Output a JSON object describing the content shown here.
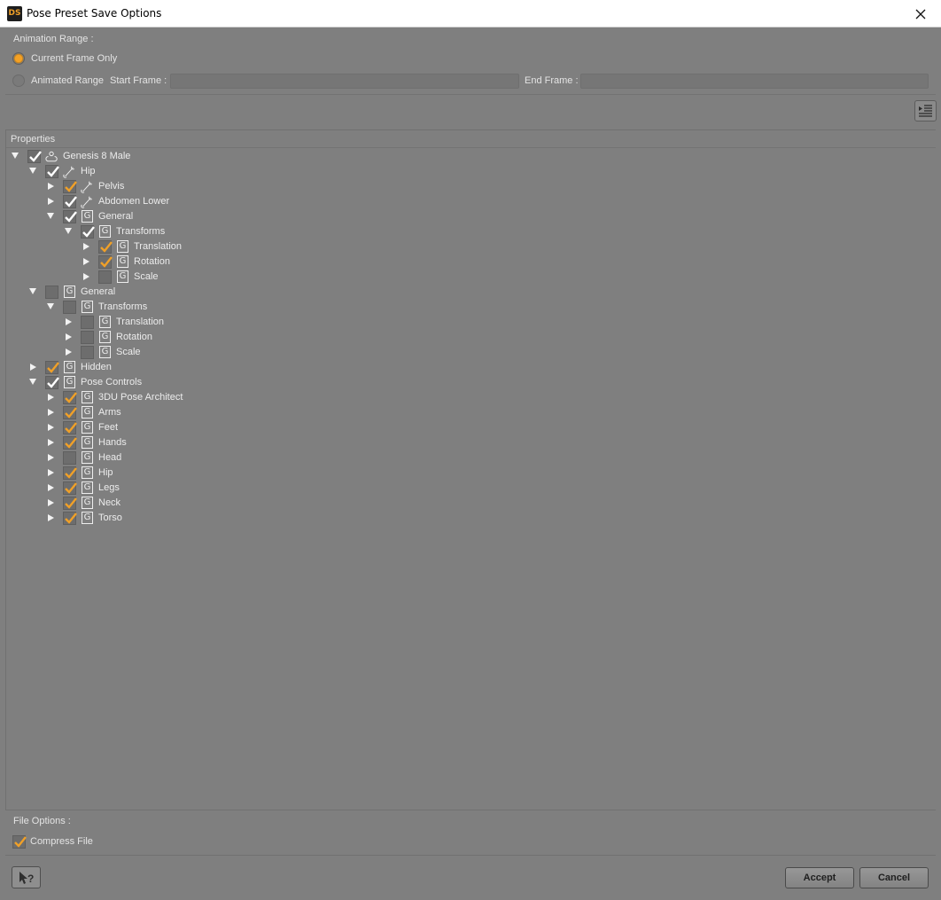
{
  "window": {
    "title": "Pose Preset Save Options",
    "app_icon_text": "DS"
  },
  "animation": {
    "section_label": "Animation Range :",
    "current_frame_label": "Current Frame Only",
    "animated_range_label": "Animated Range",
    "start_frame_label": "Start Frame :",
    "end_frame_label": "End Frame :",
    "selected": "Current Frame Only",
    "start_frame_value": "",
    "end_frame_value": ""
  },
  "properties": {
    "header": "Properties",
    "tree": [
      {
        "label": "Genesis 8 Male",
        "depth": 0,
        "expanded": true,
        "state": "white",
        "icon": "figure-icon"
      },
      {
        "label": "Hip",
        "depth": 1,
        "expanded": true,
        "state": "white",
        "icon": "bone-icon"
      },
      {
        "label": "Pelvis",
        "depth": 2,
        "expanded": false,
        "state": "orange",
        "icon": "bone-icon"
      },
      {
        "label": "Abdomen Lower",
        "depth": 2,
        "expanded": false,
        "state": "white",
        "icon": "bone-icon"
      },
      {
        "label": "General",
        "depth": 2,
        "expanded": true,
        "state": "white",
        "icon": "group-icon"
      },
      {
        "label": "Transforms",
        "depth": 3,
        "expanded": true,
        "state": "white",
        "icon": "group-icon"
      },
      {
        "label": "Translation",
        "depth": 4,
        "expanded": false,
        "state": "orange",
        "icon": "group-icon"
      },
      {
        "label": "Rotation",
        "depth": 4,
        "expanded": false,
        "state": "orange",
        "icon": "group-icon"
      },
      {
        "label": "Scale",
        "depth": 4,
        "expanded": false,
        "state": "none",
        "icon": "group-icon"
      },
      {
        "label": "General",
        "depth": 1,
        "expanded": true,
        "state": "none",
        "icon": "group-icon"
      },
      {
        "label": "Transforms",
        "depth": 2,
        "expanded": true,
        "state": "none",
        "icon": "group-icon"
      },
      {
        "label": "Translation",
        "depth": 3,
        "expanded": false,
        "state": "none",
        "icon": "group-icon"
      },
      {
        "label": "Rotation",
        "depth": 3,
        "expanded": false,
        "state": "none",
        "icon": "group-icon"
      },
      {
        "label": "Scale",
        "depth": 3,
        "expanded": false,
        "state": "none",
        "icon": "group-icon"
      },
      {
        "label": "Hidden",
        "depth": 1,
        "expanded": false,
        "state": "orange",
        "icon": "group-icon"
      },
      {
        "label": "Pose Controls",
        "depth": 1,
        "expanded": true,
        "state": "white",
        "icon": "group-icon"
      },
      {
        "label": "3DU Pose Architect",
        "depth": 2,
        "expanded": false,
        "state": "orange",
        "icon": "group-icon"
      },
      {
        "label": "Arms",
        "depth": 2,
        "expanded": false,
        "state": "orange",
        "icon": "group-icon"
      },
      {
        "label": "Feet",
        "depth": 2,
        "expanded": false,
        "state": "orange",
        "icon": "group-icon"
      },
      {
        "label": "Hands",
        "depth": 2,
        "expanded": false,
        "state": "orange",
        "icon": "group-icon"
      },
      {
        "label": "Head",
        "depth": 2,
        "expanded": false,
        "state": "none",
        "icon": "group-icon"
      },
      {
        "label": "Hip",
        "depth": 2,
        "expanded": false,
        "state": "orange",
        "icon": "group-icon"
      },
      {
        "label": "Legs",
        "depth": 2,
        "expanded": false,
        "state": "orange",
        "icon": "group-icon"
      },
      {
        "label": "Neck",
        "depth": 2,
        "expanded": false,
        "state": "orange",
        "icon": "group-icon"
      },
      {
        "label": "Torso",
        "depth": 2,
        "expanded": false,
        "state": "orange",
        "icon": "group-icon"
      }
    ]
  },
  "file_options": {
    "section_label": "File Options :",
    "compress_label": "Compress File",
    "compress_checked": true
  },
  "buttons": {
    "help_label": "?",
    "accept_label": "Accept",
    "cancel_label": "Cancel"
  },
  "colors": {
    "background": "#7f7f7f",
    "check_orange": "#f0a028",
    "check_white": "#ffffff",
    "text": "#e6e6e6"
  }
}
